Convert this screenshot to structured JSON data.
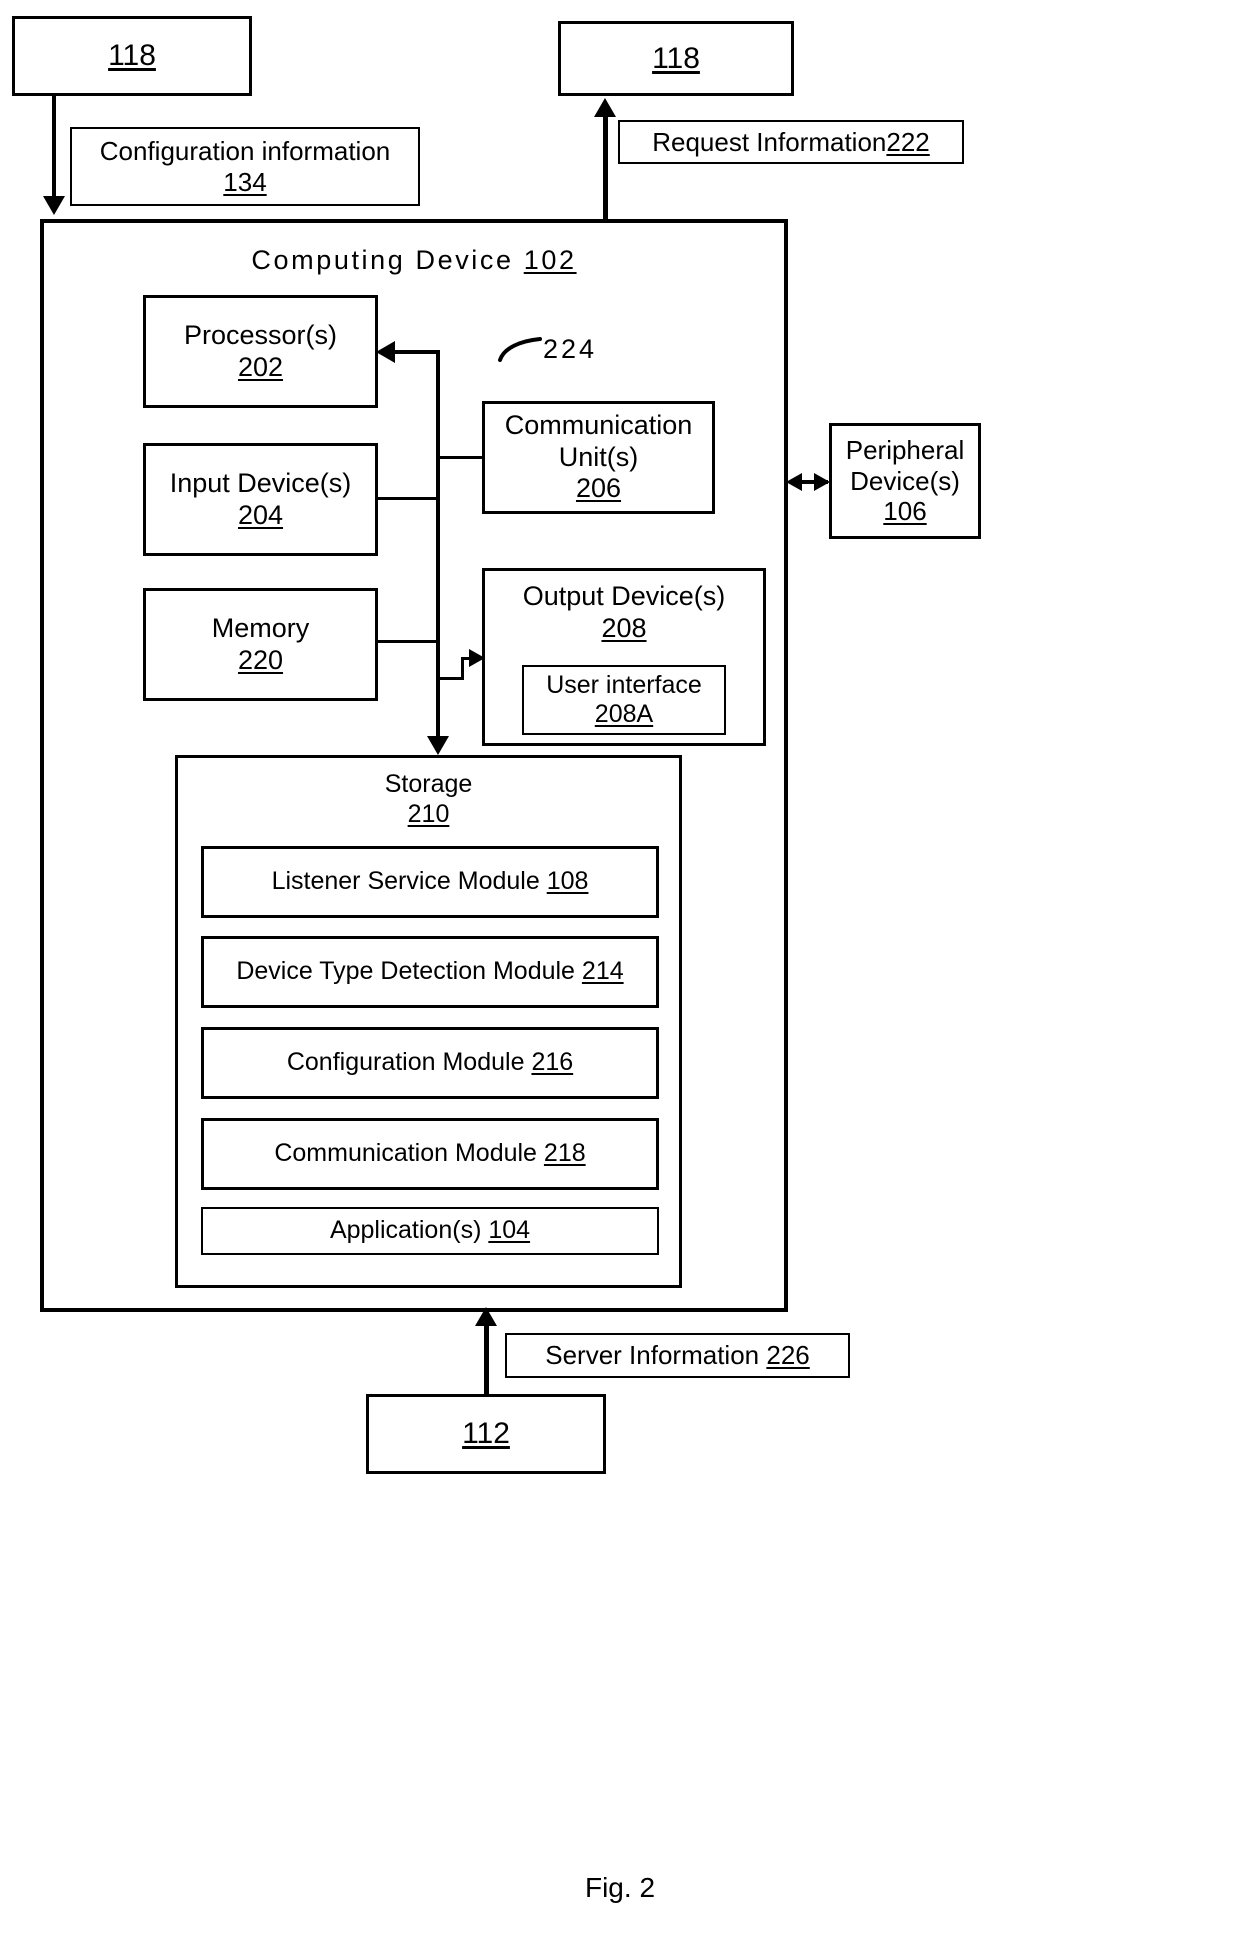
{
  "figure": {
    "caption": "Fig. 2"
  },
  "external_nodes": {
    "top_left_118": "118",
    "top_right_118": "118",
    "bottom_112": "112"
  },
  "annotations": {
    "configuration_information": {
      "text": "Configuration information",
      "ref": "134"
    },
    "request_information": {
      "text": "Request Information",
      "ref": "222"
    },
    "server_information": {
      "text": "Server Information",
      "ref": "226"
    },
    "bus_label": "224"
  },
  "computing_device": {
    "title_text": "Computing Device",
    "title_ref": "102",
    "components": {
      "processor": {
        "line1": "Processor(s)",
        "ref": "202"
      },
      "input_device": {
        "line1": "Input Device(s)",
        "ref": "204"
      },
      "memory": {
        "line1": "Memory",
        "ref": "220"
      },
      "communication_unit": {
        "line1": "Communication",
        "line2": "Unit(s)",
        "ref": "206"
      },
      "output_device": {
        "line1": "Output Device(s)",
        "ref": "208"
      },
      "user_interface": {
        "line1": "User interface",
        "ref": "208A"
      }
    },
    "storage": {
      "title_text": "Storage",
      "title_ref": "210",
      "modules": [
        {
          "text": "Listener Service Module",
          "ref": "108"
        },
        {
          "text": "Device Type Detection Module",
          "ref": "214"
        },
        {
          "text": "Configuration Module",
          "ref": "216"
        },
        {
          "text": "Communication Module",
          "ref": "218"
        },
        {
          "text": "Application(s)",
          "ref": "104"
        }
      ]
    }
  },
  "peripheral_device": {
    "line1": "Peripheral",
    "line2": "Device(s)",
    "ref": "106"
  },
  "colors": {
    "stroke": "#000000",
    "background": "#ffffff"
  }
}
